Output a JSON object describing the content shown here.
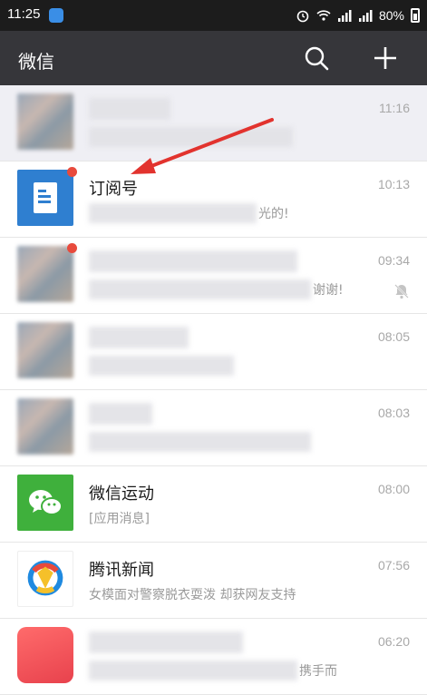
{
  "status_bar": {
    "time": "11:25",
    "battery": "80%"
  },
  "app_bar": {
    "title": "微信"
  },
  "chats": [
    {
      "name": "",
      "preview": "",
      "time": "11:16",
      "pinned": true
    },
    {
      "name": "订阅号",
      "preview": "光的!",
      "time": "10:13",
      "unread": true
    },
    {
      "name": "",
      "preview": "谢谢!",
      "time": "09:34",
      "unread": true,
      "muted": true
    },
    {
      "name": "",
      "preview": "",
      "time": "08:05"
    },
    {
      "name": "",
      "preview": "",
      "time": "08:03"
    },
    {
      "name": "微信运动",
      "preview": "[应用消息]",
      "time": "08:00"
    },
    {
      "name": "腾讯新闻",
      "preview": "女模面对警察脱衣耍泼 却获网友支持",
      "time": "07:56"
    },
    {
      "name": "",
      "preview": "携手而",
      "time": "06:20"
    }
  ],
  "colors": {
    "accent_red": "#e84a3c",
    "appbar_bg": "#36363a",
    "statusbar_bg": "#1c1c1c"
  }
}
